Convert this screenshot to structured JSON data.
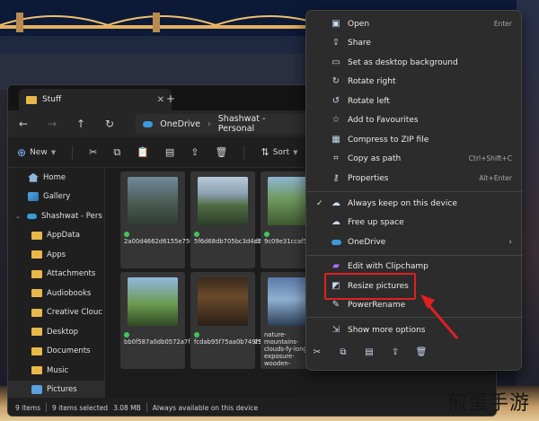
{
  "window": {
    "tab_title": "Stuff",
    "tab_close": "✕",
    "new_tab": "+"
  },
  "address": {
    "crumbs": [
      "OneDrive",
      "Shashwat - Personal"
    ],
    "separator": "›"
  },
  "toolbar": {
    "new_label": "New",
    "sort_label": "Sort"
  },
  "sidebar": {
    "items": [
      {
        "label": "Home",
        "icon": "home-icon"
      },
      {
        "label": "Gallery",
        "icon": "gallery-icon"
      },
      {
        "label": "Shashwat - Pers",
        "icon": "onedrive-icon"
      },
      {
        "label": "AppData",
        "icon": "folder-icon"
      },
      {
        "label": "Apps",
        "icon": "folder-icon"
      },
      {
        "label": "Attachments",
        "icon": "folder-icon"
      },
      {
        "label": "Audiobooks",
        "icon": "folder-icon"
      },
      {
        "label": "Creative Clouc",
        "icon": "folder-icon"
      },
      {
        "label": "Desktop",
        "icon": "folder-icon"
      },
      {
        "label": "Documents",
        "icon": "folder-icon"
      },
      {
        "label": "Music",
        "icon": "folder-icon"
      },
      {
        "label": "Pictures",
        "icon": "pictures-icon"
      }
    ]
  },
  "files": [
    {
      "name": "2a00d4662d6155e75022c3a34229bbda0cc7ff4309b514e0f18"
    },
    {
      "name": "5f6d68db705bc3d4db329fd8d4e1f20b941a857a1e30df336f"
    },
    {
      "name": "9c09e31ccaf56f9820cb9d4d46c55229599723291e29"
    },
    {
      "name": "bb0f587a0db0572a7f0897d4ad538a5fd91259f16df486474df"
    },
    {
      "name": "fcdab95f75aa0b749f9a490bee80cb42779e301af7353a97eaa"
    },
    {
      "name": "nature-mountains-clouds-fy-long-exposure-wooden-"
    }
  ],
  "status": {
    "items_count": "9 items",
    "selected": "9 items selected",
    "size": "3.08 MB",
    "availability": "Always available on this device"
  },
  "context_menu": {
    "open": {
      "label": "Open",
      "shortcut": "Enter"
    },
    "share": {
      "label": "Share"
    },
    "set_bg": {
      "label": "Set as desktop background"
    },
    "rotate_right": {
      "label": "Rotate right"
    },
    "rotate_left": {
      "label": "Rotate left"
    },
    "add_fav": {
      "label": "Add to Favourites"
    },
    "compress": {
      "label": "Compress to ZIP file"
    },
    "copy_path": {
      "label": "Copy as path",
      "shortcut": "Ctrl+Shift+C"
    },
    "properties": {
      "label": "Properties",
      "shortcut": "Alt+Enter"
    },
    "keep": {
      "label": "Always keep on this device",
      "check": "✓"
    },
    "free_up": {
      "label": "Free up space"
    },
    "onedrive": {
      "label": "OneDrive",
      "arrow": "›"
    },
    "clipchamp": {
      "label": "Edit with Clipchamp"
    },
    "resize": {
      "label": "Resize pictures"
    },
    "powerrename": {
      "label": "PowerRename"
    },
    "more": {
      "label": "Show more options"
    }
  },
  "watermark": "煎蛋手游"
}
